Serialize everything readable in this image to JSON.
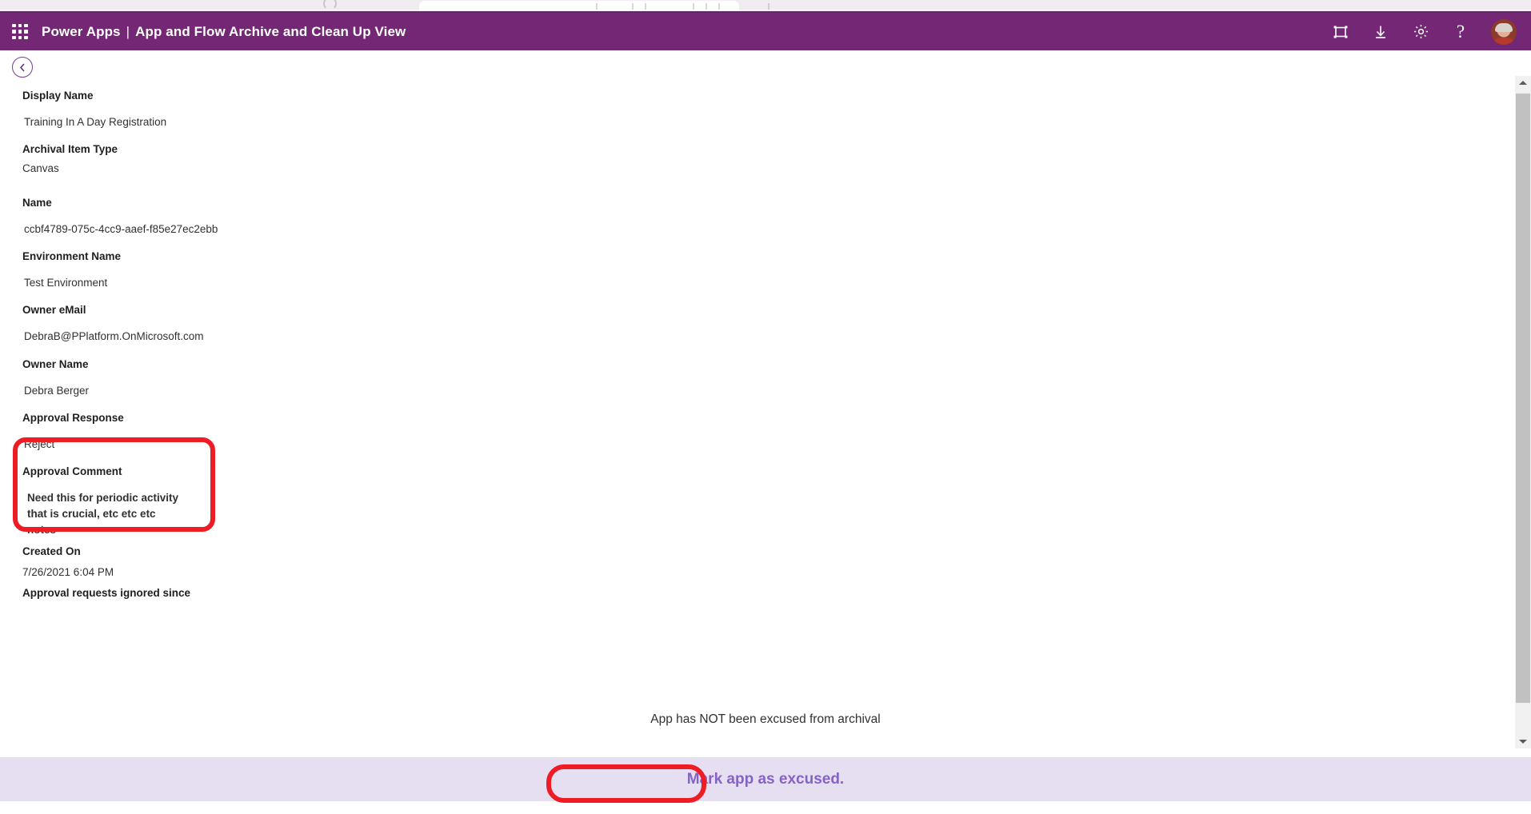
{
  "header": {
    "waffle_icon": "app-launcher-icon",
    "product": "Power Apps",
    "separator": "|",
    "app_title": "App and Flow Archive and Clean Up View",
    "icons": [
      {
        "name": "fullscreen-icon",
        "label": "Full screen"
      },
      {
        "name": "download-icon",
        "label": "Download"
      },
      {
        "name": "gear-icon",
        "label": "Settings"
      },
      {
        "name": "help-icon",
        "label": "?"
      }
    ],
    "avatar_name": "user-avatar"
  },
  "nav": {
    "back_icon": "chevron-left-icon",
    "back_label": "Back"
  },
  "form": {
    "fields": [
      {
        "label": "Display Name",
        "value": "Training In A Day Registration"
      },
      {
        "label": "Archival Item Type",
        "value": "Canvas"
      },
      {
        "label": "Name",
        "value": "ccbf4789-075c-4cc9-aaef-f85e27ec2ebb"
      },
      {
        "label": "Environment Name",
        "value": "Test Environment"
      },
      {
        "label": "Owner eMail",
        "value": "DebraB@PPlatform.OnMicrosoft.com"
      },
      {
        "label": "Owner Name",
        "value": "Debra Berger"
      },
      {
        "label": "Approval Response",
        "value": "Reject"
      },
      {
        "label": "Approval Comment",
        "value": "Need this for periodic activity that is crucial, etc etc etc notes"
      },
      {
        "label": "Created On",
        "value": "7/26/2021 6:04 PM"
      },
      {
        "label": "Approval requests ignored since",
        "value": ""
      }
    ]
  },
  "footer": {
    "status_text": "App has NOT been excused from archival",
    "excuse_button_label": "Mark app as excused."
  },
  "annotations": [
    {
      "name": "annotation-approval-comment",
      "color": "#ee1c25"
    },
    {
      "name": "annotation-excuse-button",
      "color": "#ee1c25"
    }
  ],
  "scrollbar": {
    "up_icon": "caret-up-icon",
    "down_icon": "caret-down-icon"
  },
  "colors": {
    "header_purple": "#742774",
    "bottom_bar": "#e6dff1",
    "button_text": "#8463c5",
    "annotation_red": "#ee1c25"
  }
}
